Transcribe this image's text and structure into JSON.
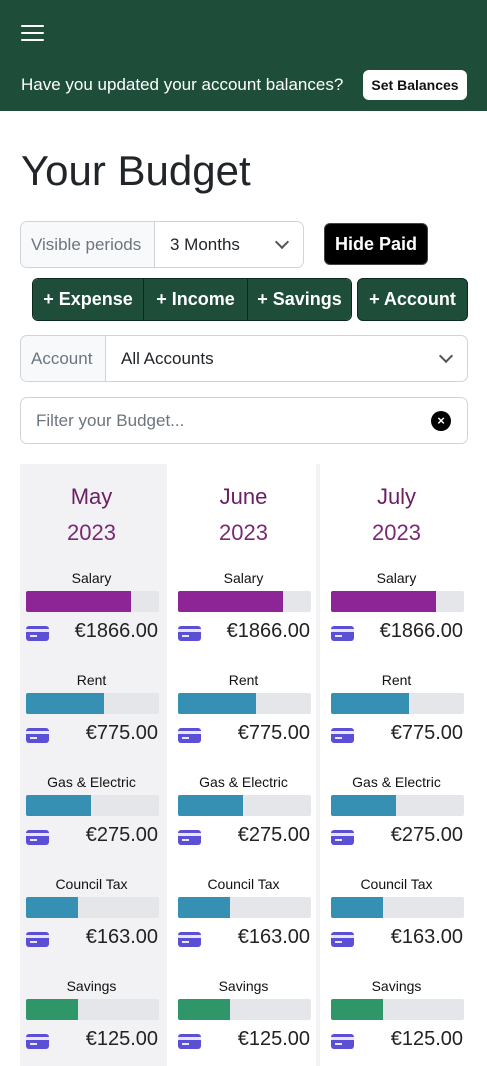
{
  "header": {
    "banner_text": "Have you updated your account balances?",
    "set_balances_label": "Set Balances"
  },
  "page_title": "Your Budget",
  "controls": {
    "visible_periods_label": "Visible periods",
    "visible_periods_value": "3 Months",
    "hide_paid_label": "Hide Paid",
    "add_expense_label": "+ Expense",
    "add_income_label": "+ Income",
    "add_savings_label": "+ Savings",
    "add_account_label": "+ Account",
    "account_label": "Account",
    "account_value": "All Accounts",
    "filter_placeholder": "Filter your Budget...",
    "clear_symbol": "×"
  },
  "periods": [
    {
      "month": "May",
      "year": "2023",
      "current": true,
      "items": [
        {
          "name": "Salary",
          "amount": "€1866.00",
          "progress": 0.79,
          "color": "#8e2596"
        },
        {
          "name": "Rent",
          "amount": "€775.00",
          "progress": 0.59,
          "color": "#3590b4"
        },
        {
          "name": "Gas & Electric",
          "amount": "€275.00",
          "progress": 0.49,
          "color": "#3590b4"
        },
        {
          "name": "Council Tax",
          "amount": "€163.00",
          "progress": 0.39,
          "color": "#3590b4"
        },
        {
          "name": "Savings",
          "amount": "€125.00",
          "progress": 0.39,
          "color": "#2f9669"
        }
      ]
    },
    {
      "month": "June",
      "year": "2023",
      "current": false,
      "items": [
        {
          "name": "Salary",
          "amount": "€1866.00",
          "progress": 0.79,
          "color": "#8e2596"
        },
        {
          "name": "Rent",
          "amount": "€775.00",
          "progress": 0.59,
          "color": "#3590b4"
        },
        {
          "name": "Gas & Electric",
          "amount": "€275.00",
          "progress": 0.49,
          "color": "#3590b4"
        },
        {
          "name": "Council Tax",
          "amount": "€163.00",
          "progress": 0.39,
          "color": "#3590b4"
        },
        {
          "name": "Savings",
          "amount": "€125.00",
          "progress": 0.39,
          "color": "#2f9669"
        }
      ]
    },
    {
      "month": "July",
      "year": "2023",
      "current": false,
      "items": [
        {
          "name": "Salary",
          "amount": "€1866.00",
          "progress": 0.79,
          "color": "#8e2596"
        },
        {
          "name": "Rent",
          "amount": "€775.00",
          "progress": 0.59,
          "color": "#3590b4"
        },
        {
          "name": "Gas & Electric",
          "amount": "€275.00",
          "progress": 0.49,
          "color": "#3590b4"
        },
        {
          "name": "Council Tax",
          "amount": "€163.00",
          "progress": 0.39,
          "color": "#3590b4"
        },
        {
          "name": "Savings",
          "amount": "€125.00",
          "progress": 0.39,
          "color": "#2f9669"
        }
      ]
    }
  ],
  "colors": {
    "brand": "#1e4d3a",
    "month_text": "#6b1f63",
    "card_icon": "#5b4fd6"
  }
}
